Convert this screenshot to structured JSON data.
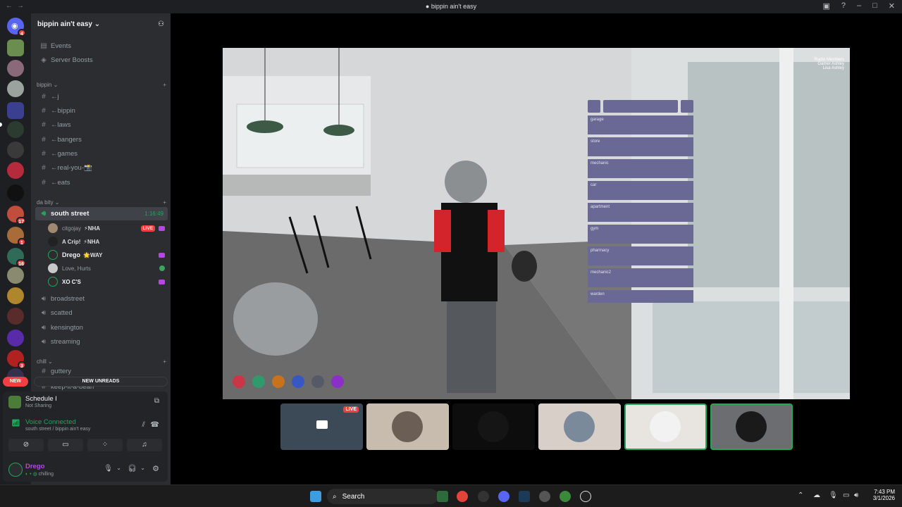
{
  "window": {
    "title": "bippin ain't easy"
  },
  "server": {
    "name": "bippin ain't easy"
  },
  "top_links": [
    "Events",
    "Server Boosts"
  ],
  "categories": {
    "bippin": "bippin",
    "da_bity": "da bity",
    "chill": "chill"
  },
  "text_channels": [
    "←j",
    "←bippin",
    "←laws",
    "←bangers",
    "←games",
    "←real-you-📸",
    "←eats"
  ],
  "voice_active": {
    "name": "south street",
    "timer": "1:16:49"
  },
  "voice_users": [
    {
      "name": "citgojay",
      "tag": "⚡NHA",
      "live": "LIVE"
    },
    {
      "name": "A Crip!",
      "tag": "⚡NHA"
    },
    {
      "name": "Drego",
      "tag": "🌟WAY"
    },
    {
      "name": "Love, Hurts",
      "tag": ""
    },
    {
      "name": "XO C'S",
      "tag": ""
    }
  ],
  "voice_channels": [
    "broadstreet",
    "scatted",
    "kensington",
    "streaming"
  ],
  "chill_channels": [
    "guttery",
    "keep-it-a-bean"
  ],
  "new_unreads": "NEW UNREADS",
  "new_pill": "NEW",
  "guild_badges": [
    "4",
    "17",
    "1",
    "16",
    "3"
  ],
  "activity": {
    "title": "Schedule I",
    "subtitle": "Not Sharing"
  },
  "voice_status": {
    "title": "Voice Connected",
    "subtitle": "south street / bippin ain't easy"
  },
  "user": {
    "name": "Drego",
    "status": "chilling"
  },
  "game_hud": {
    "radio_title": "Radio Members",
    "radio_lines": [
      "Gamer Ashley",
      "Lisa Ashley"
    ],
    "menu_items": [
      "garage",
      "store",
      "mechanic",
      "car",
      "apartment",
      "gym",
      "pharmacy",
      "mechanic2",
      "warden"
    ]
  },
  "taskbar": {
    "search_placeholder": "Search",
    "time": "7:43 PM",
    "date": "3/1/2026"
  },
  "colors": {
    "accent": "#5865f2",
    "green": "#23a55a",
    "red": "#f23f43",
    "menu": "#6a6894"
  }
}
